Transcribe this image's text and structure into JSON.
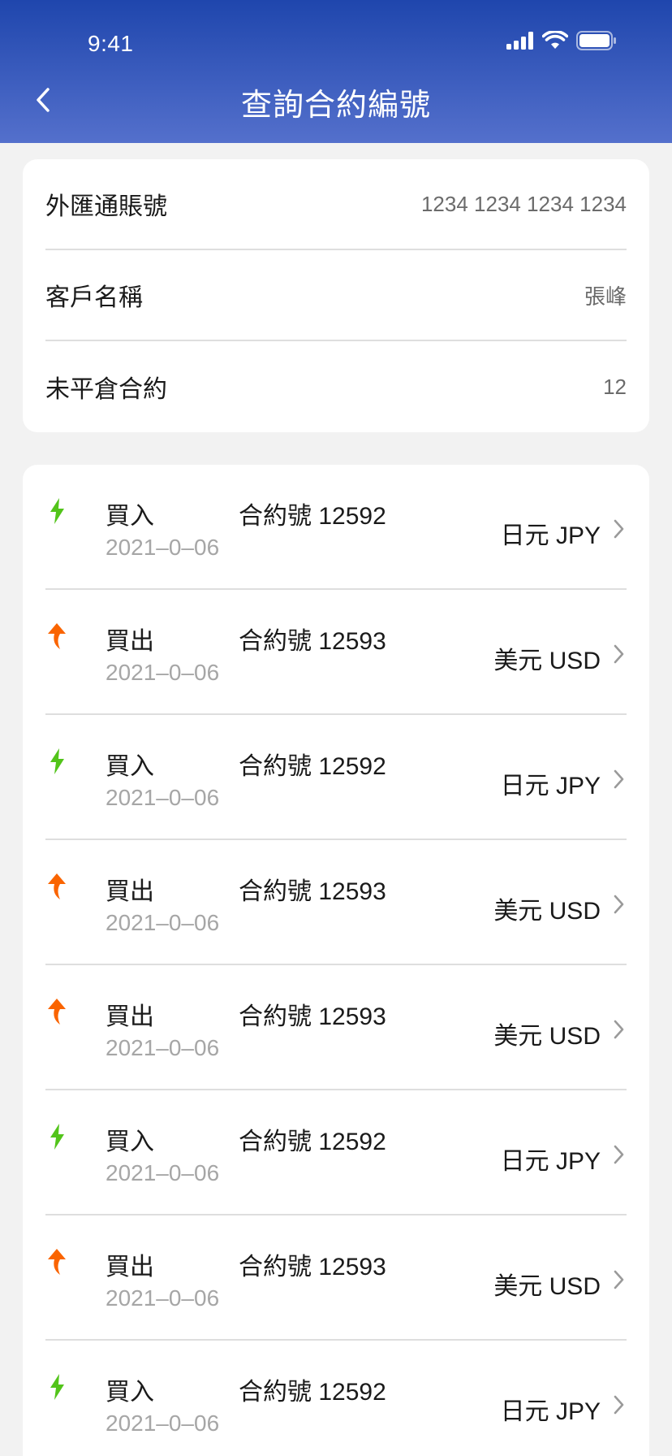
{
  "status_bar": {
    "time": "9:41"
  },
  "header": {
    "title": "查詢合約編號"
  },
  "account_info": [
    {
      "label": "外匯通賬號",
      "value": "1234 1234 1234 1234"
    },
    {
      "label": "客戶名稱",
      "value": "張峰"
    },
    {
      "label": "未平倉合約",
      "value": "12"
    }
  ],
  "contracts": [
    {
      "direction": "buy",
      "type": "買入",
      "contract_no": "合約號 12592",
      "date": "2021–0–06",
      "currency": "日元 JPY"
    },
    {
      "direction": "sell",
      "type": "買出",
      "contract_no": "合約號 12593",
      "date": "2021–0–06",
      "currency": "美元 USD"
    },
    {
      "direction": "buy",
      "type": "買入",
      "contract_no": "合約號 12592",
      "date": "2021–0–06",
      "currency": "日元 JPY"
    },
    {
      "direction": "sell",
      "type": "買出",
      "contract_no": "合約號 12593",
      "date": "2021–0–06",
      "currency": "美元 USD"
    },
    {
      "direction": "sell",
      "type": "買出",
      "contract_no": "合約號 12593",
      "date": "2021–0–06",
      "currency": "美元 USD"
    },
    {
      "direction": "buy",
      "type": "買入",
      "contract_no": "合約號 12592",
      "date": "2021–0–06",
      "currency": "日元 JPY"
    },
    {
      "direction": "sell",
      "type": "買出",
      "contract_no": "合約號 12593",
      "date": "2021–0–06",
      "currency": "美元 USD"
    },
    {
      "direction": "buy",
      "type": "買入",
      "contract_no": "合約號 12592",
      "date": "2021–0–06",
      "currency": "日元 JPY"
    }
  ],
  "colors": {
    "header_top": "#1f46ad",
    "header_bottom": "#5470cc",
    "buy_arrow": "#52c41a",
    "sell_arrow": "#fa6400"
  },
  "icons": {
    "back": "chevron-left-icon",
    "buy": "green-down-arrow-icon",
    "sell": "orange-up-arrow-icon",
    "row_action": "chevron-right-icon"
  }
}
